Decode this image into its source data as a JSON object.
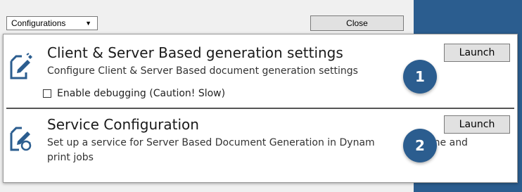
{
  "toolbar": {
    "dropdown_value": "Configurations",
    "close_label": "Close"
  },
  "section1": {
    "title": "Client & Server Based generation settings",
    "description": "Configure Client & Server Based document generation settings",
    "checkbox_label": "Enable debugging (Caution! Slow)",
    "checkbox_checked": false,
    "launch_label": "Launch",
    "badge": "1",
    "icon": "document-edit-icon"
  },
  "section2": {
    "title": "Service Configuration",
    "description_line1": "Set up a service for Server Based Document Generation in Dynam",
    "description_line1_tail": "S-Online and",
    "description_line2": "print jobs",
    "launch_label": "Launch",
    "badge": "2",
    "icon": "document-refresh-icon"
  },
  "colors": {
    "accent": "#2b5d8f",
    "badge_text": "#ffffff"
  }
}
